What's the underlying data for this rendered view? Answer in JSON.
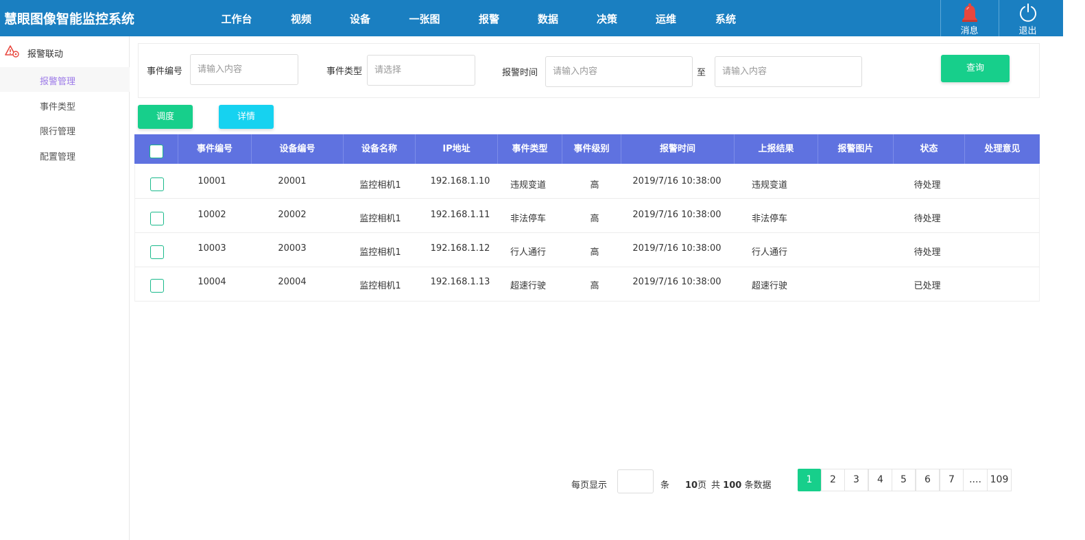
{
  "app": {
    "title": "慧眼图像智能监控系统"
  },
  "nav": {
    "items": [
      "工作台",
      "视频",
      "设备",
      "一张图",
      "报警",
      "数据",
      "决策",
      "运维",
      "系统"
    ]
  },
  "header_buttons": {
    "messages": "消息",
    "logout": "退出"
  },
  "sidebar": {
    "group": "报警联动",
    "items": [
      "报警管理",
      "事件类型",
      "限行管理",
      "配置管理"
    ],
    "active_index": 0
  },
  "filters": {
    "event_no_label": "事件编号",
    "event_no_placeholder": "请输入内容",
    "event_type_label": "事件类型",
    "event_type_placeholder": "请选择",
    "alarm_time_label": "报警时间",
    "time_from_placeholder": "请输入内容",
    "to_label": "至",
    "time_to_placeholder": "请输入内容",
    "query_label": "查询"
  },
  "actions": {
    "dispatch": "调度",
    "detail": "详情"
  },
  "table": {
    "columns": [
      "事件编号",
      "设备编号",
      "设备名称",
      "IP地址",
      "事件类型",
      "事件级别",
      "报警时间",
      "上报结果",
      "报警图片",
      "状态",
      "处理意见"
    ],
    "rows": [
      [
        "10001",
        "20001",
        "监控相机1",
        "192.168.1.10",
        "违规变道",
        "高",
        "2019/7/16 10:38:00",
        "违规变道",
        "",
        "待处理",
        ""
      ],
      [
        "10002",
        "20002",
        "监控相机1",
        "192.168.1.11",
        "非法停车",
        "高",
        "2019/7/16 10:38:00",
        "非法停车",
        "",
        "待处理",
        ""
      ],
      [
        "10003",
        "20003",
        "监控相机1",
        "192.168.1.12",
        "行人通行",
        "高",
        "2019/7/16 10:38:00",
        "行人通行",
        "",
        "待处理",
        ""
      ],
      [
        "10004",
        "20004",
        "监控相机1",
        "192.168.1.13",
        "超速行驶",
        "高",
        "2019/7/16 10:38:00",
        "超速行驶",
        "",
        "已处理",
        ""
      ]
    ]
  },
  "pagination": {
    "per_page_label": "每页显示",
    "per_page_value": "",
    "unit": "条",
    "pages_count": "10",
    "pages_suffix": "页",
    "total_prefix": "共",
    "total_count": "100",
    "total_suffix": "条数据",
    "pages": [
      "1",
      "2",
      "3",
      "4",
      "5",
      "6",
      "7",
      "....",
      "109"
    ],
    "active_page": "1"
  },
  "colors": {
    "topbar": "#1a7fc1",
    "table_header": "#5f72e0",
    "primary_green": "#17cf8b",
    "cyan": "#16d2f0",
    "active_side": "#9d7be8",
    "bell": "#e8473e"
  },
  "icons": {
    "alarm_group": "alarm-warning-icon",
    "messages": "bell-icon",
    "logout": "power-icon"
  }
}
